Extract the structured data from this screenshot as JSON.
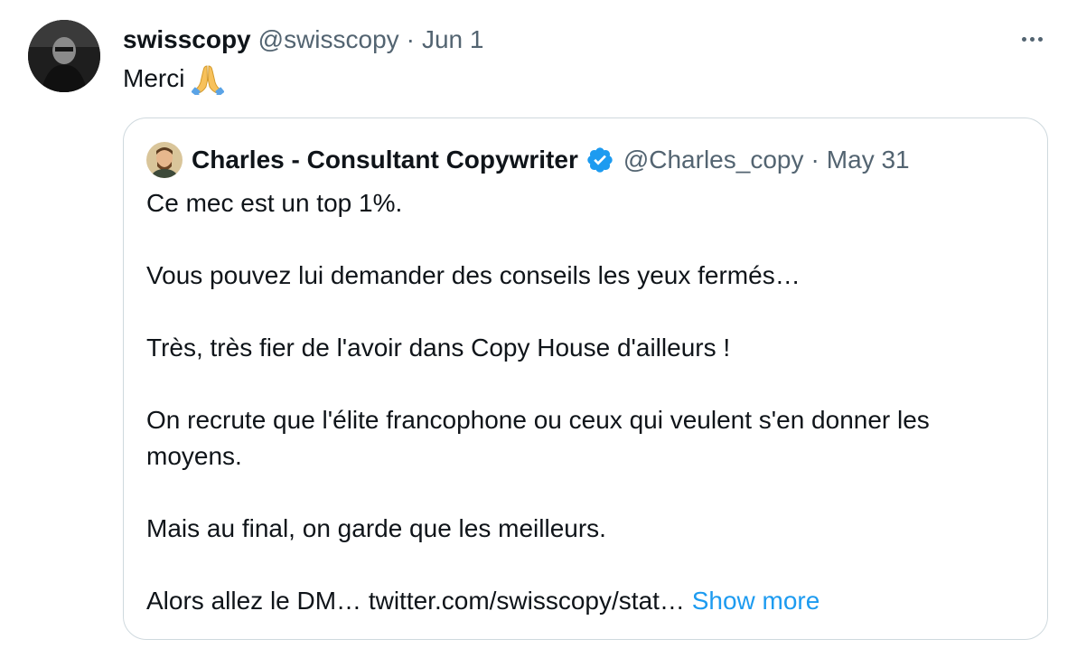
{
  "tweet": {
    "author_name": "swisscopy",
    "author_handle": "@swisscopy",
    "separator": "·",
    "date": "Jun 1",
    "text": "Merci",
    "emoji_icon": "folded-hands-icon",
    "more_icon": "more-horizontal-icon"
  },
  "quote": {
    "author_name": "Charles - Consultant Copywriter",
    "verified_icon": "verified-badge-icon",
    "author_handle": "@Charles_copy",
    "separator": "·",
    "date": "May 31",
    "paragraphs": [
      "Ce mec est un top 1%.",
      "Vous pouvez lui demander des conseils les yeux fermés…",
      "Très, très fier de l'avoir dans Copy House d'ailleurs !",
      "On recrute que l'élite francophone ou ceux qui veulent s'en donner les moyens.",
      "Mais au final, on garde que les meilleurs."
    ],
    "last_line": "Alors allez le DM… twitter.com/swisscopy/stat…",
    "show_more": "Show more"
  },
  "colors": {
    "text_primary": "#0f1419",
    "text_secondary": "#536471",
    "link": "#1d9bf0",
    "border": "#cfd9de",
    "verified": "#1d9bf0"
  }
}
